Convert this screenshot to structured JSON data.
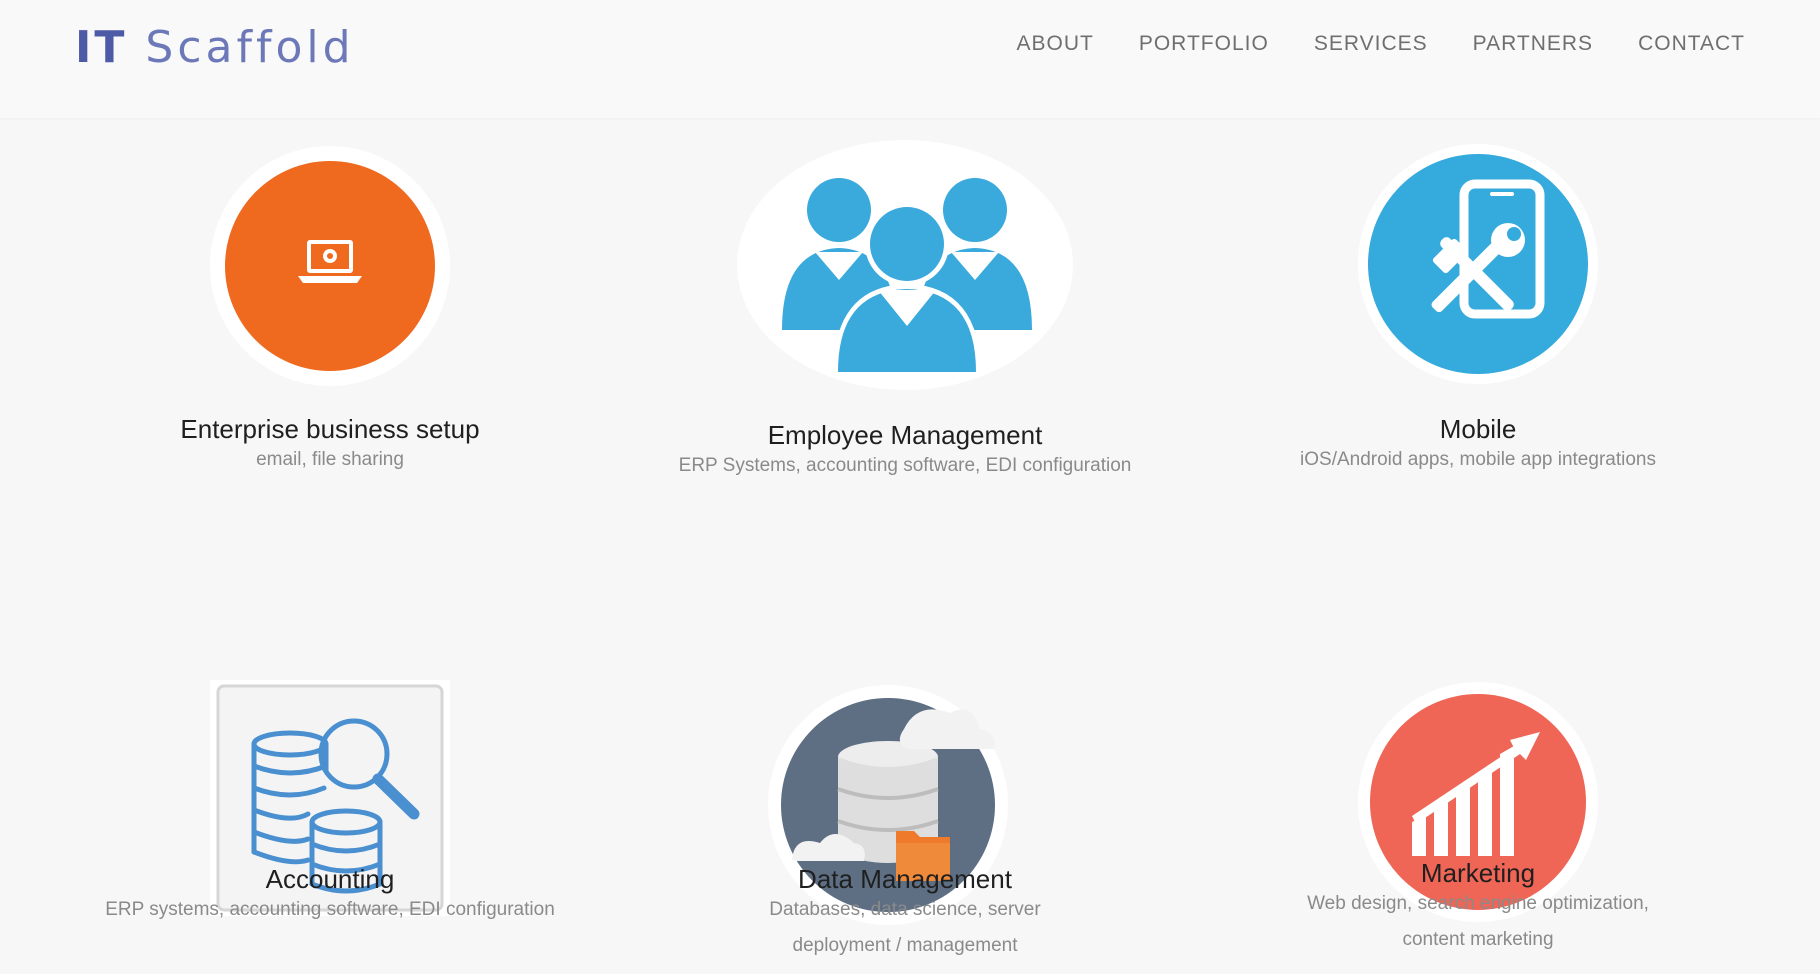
{
  "brand": {
    "part1": "IT",
    "part2": "Scaffold",
    "color": "#4d5aa6"
  },
  "nav": {
    "items": [
      "ABOUT",
      "PORTFOLIO",
      "SERVICES",
      "PARTNERS",
      "CONTACT"
    ]
  },
  "services": [
    {
      "title": "Enterprise business setup",
      "desc": "email, file sharing",
      "icon": "laptop-gear-icon",
      "color": "#ef6a1f"
    },
    {
      "title": "Employee Management",
      "desc": "ERP Systems, accounting software, EDI configuration",
      "icon": "people-group-icon",
      "color": "#3aa9dc"
    },
    {
      "title": "Mobile",
      "desc": "iOS/Android apps, mobile app integrations",
      "icon": "mobile-tools-icon",
      "color": "#35aadd"
    },
    {
      "title": "Accounting",
      "desc": "ERP systems, accounting software, EDI configuration",
      "icon": "database-search-icon",
      "color": "#4a8fd0"
    },
    {
      "title": "Data Management",
      "desc": "Databases, data science, server deployment / management",
      "icon": "database-cloud-icon",
      "color": "#5e6f84"
    },
    {
      "title": "Marketing",
      "desc": "Web design, search engine optimization, content marketing",
      "icon": "growth-chart-icon",
      "color": "#ef6656"
    }
  ]
}
